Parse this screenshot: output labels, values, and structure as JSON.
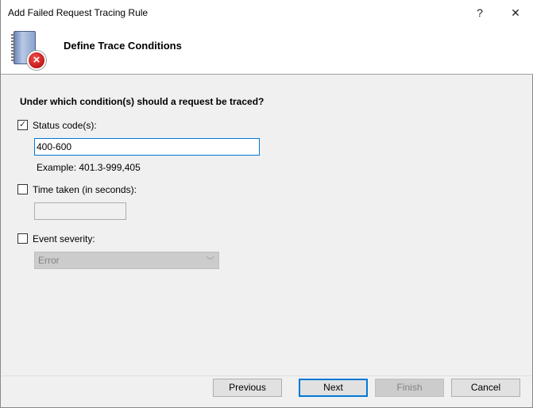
{
  "window": {
    "title": "Add Failed Request Tracing Rule",
    "help": "?",
    "close": "✕"
  },
  "header": {
    "title": "Define Trace Conditions",
    "icon": "trace-error-icon"
  },
  "question": "Under which condition(s) should a request be traced?",
  "status_code": {
    "label": "Status code(s):",
    "checked": true,
    "value": "400-600",
    "example": "Example: 401.3-999,405"
  },
  "time_taken": {
    "label": "Time taken (in seconds):",
    "checked": false,
    "value": ""
  },
  "event_severity": {
    "label": "Event severity:",
    "checked": false,
    "selected": "Error"
  },
  "buttons": {
    "previous": "Previous",
    "next": "Next",
    "finish": "Finish",
    "cancel": "Cancel"
  }
}
